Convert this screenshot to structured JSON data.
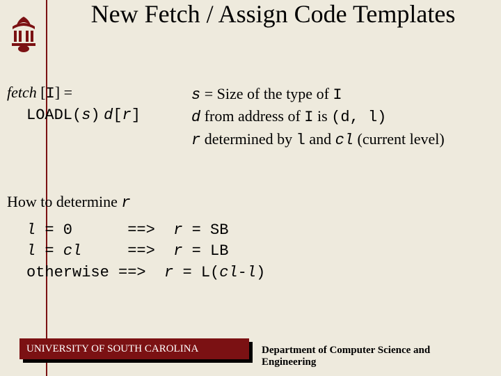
{
  "slide": {
    "title": "New Fetch / Assign Code Templates",
    "fetch": {
      "label": "fetch",
      "arg": "I",
      "eq": "="
    },
    "load": {
      "instr": "LOADL(",
      "s": "s",
      "close": ")",
      "d": "d",
      "lb": "[",
      "r": "r",
      "rb": "]"
    },
    "rhs": {
      "l1a": "s",
      "l1b": " = Size of the type of ",
      "l1c": "I",
      "l2a": "d",
      "l2b": " from address of ",
      "l2c": "I",
      "l2d": " is ",
      "l2e": "(d, l)",
      "l3a": "r",
      "l3b": " determined by ",
      "l3c": "l",
      "l3d": " and ",
      "l3e": "cl",
      "l3f": " (current level)"
    },
    "how": {
      "text": "How to determine ",
      "r": "r"
    },
    "rules": {
      "r1a": "l",
      "r1b": " = 0      ==>  ",
      "r1c": "r",
      "r1d": " = SB",
      "r2a": "l",
      "r2b": " = ",
      "r2c": "cl",
      "r2d": "     ==>  ",
      "r2e": "r",
      "r2f": " = LB",
      "r3a": "otherwise ==>  ",
      "r3b": "r",
      "r3c": " = L(",
      "r3d": "cl",
      "r3e": "-",
      "r3f": "l",
      "r3g": ")"
    }
  },
  "footer": {
    "university": "UNIVERSITY OF SOUTH CAROLINA",
    "department": "Department of Computer Science and Engineering"
  }
}
